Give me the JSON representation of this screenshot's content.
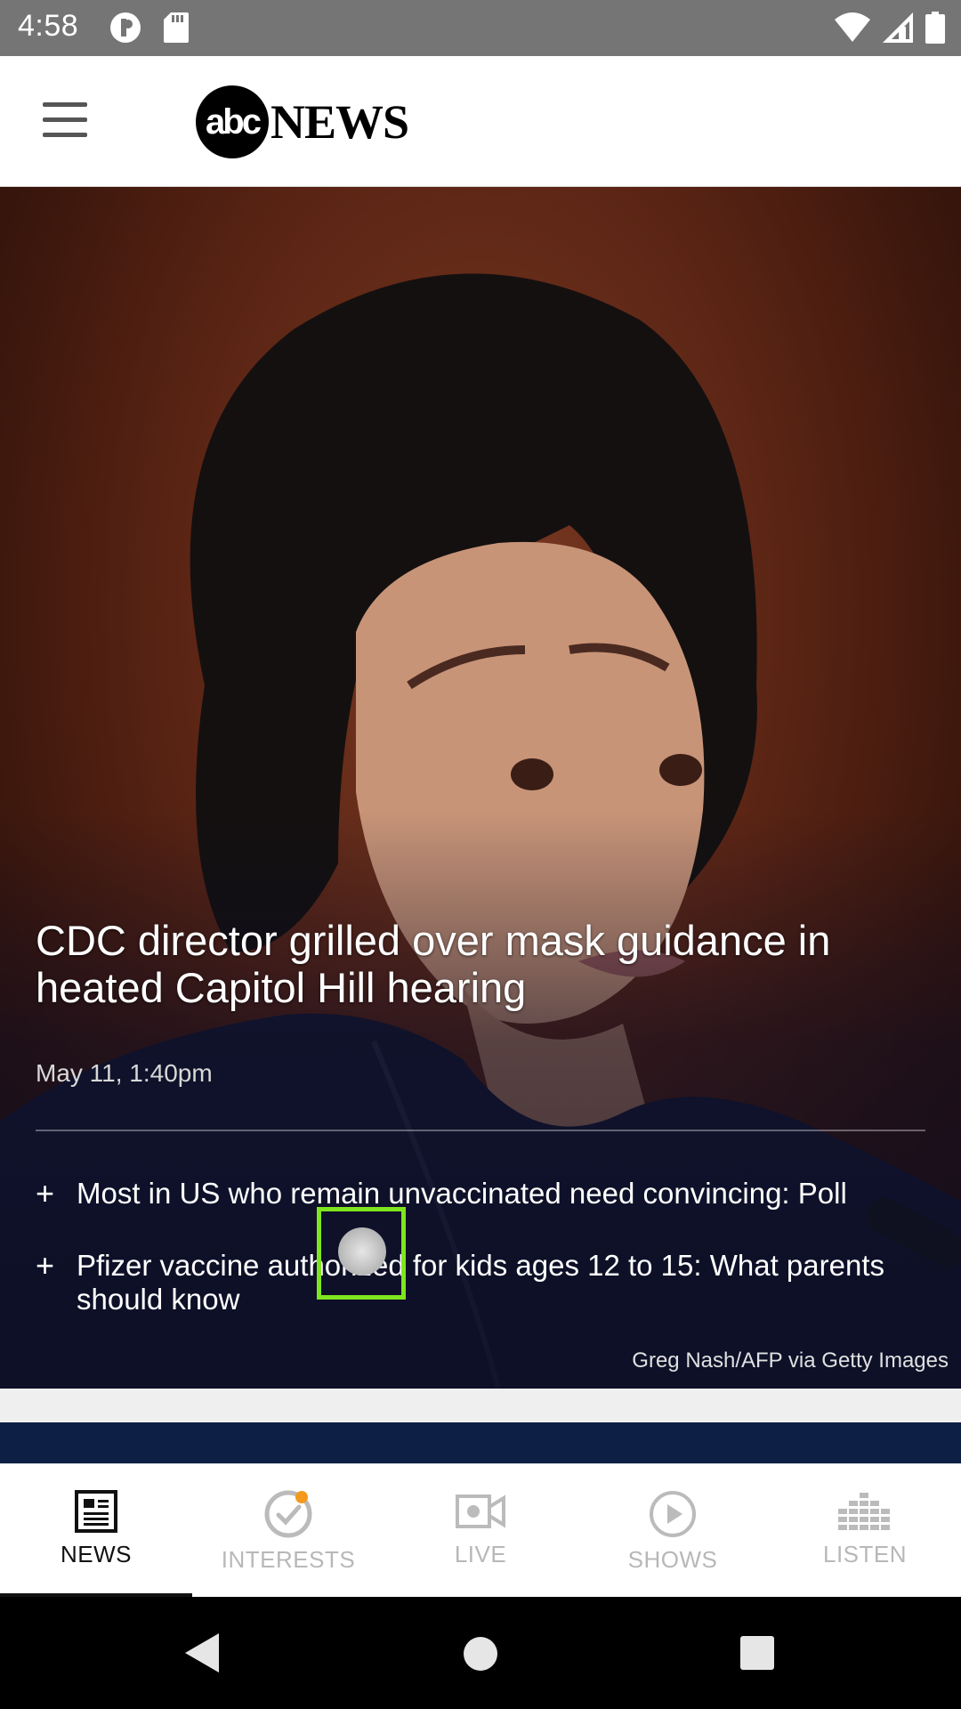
{
  "status_bar": {
    "time": "4:58",
    "icons": [
      "profile-icon",
      "sd-card-icon",
      "wifi-icon",
      "signal-icon",
      "battery-icon"
    ]
  },
  "header": {
    "logo_mark": "abc",
    "logo_word": "NEWS",
    "icons": [
      "hamburger-menu-icon"
    ]
  },
  "hero": {
    "headline": "CDC director grilled over mask guidance in heated Capitol Hill hearing",
    "timestamp": "May 11, 1:40pm",
    "related": [
      "Most in US who remain unvaccinated need convincing: Poll",
      "Pfizer vaccine authorized for kids ages 12 to 15: What parents should know"
    ],
    "photo_credit": "Greg Nash/AFP via Getty Images",
    "related_bullet": "+"
  },
  "touch_overlay": {
    "label": "touch: 100%"
  },
  "tabs": [
    {
      "label": "NEWS",
      "icon": "newspaper-icon",
      "active": true
    },
    {
      "label": "INTERESTS",
      "icon": "check-circle-icon",
      "active": false
    },
    {
      "label": "LIVE",
      "icon": "video-camera-icon",
      "active": false
    },
    {
      "label": "SHOWS",
      "icon": "play-circle-icon",
      "active": false
    },
    {
      "label": "LISTEN",
      "icon": "equalizer-icon",
      "active": false
    }
  ],
  "nav": {
    "icons": [
      "back-icon",
      "home-icon",
      "recents-icon"
    ]
  },
  "colors": {
    "accent_dot": "#f39a1e",
    "navy": "#0d1f44",
    "status_bar": "#757575"
  }
}
